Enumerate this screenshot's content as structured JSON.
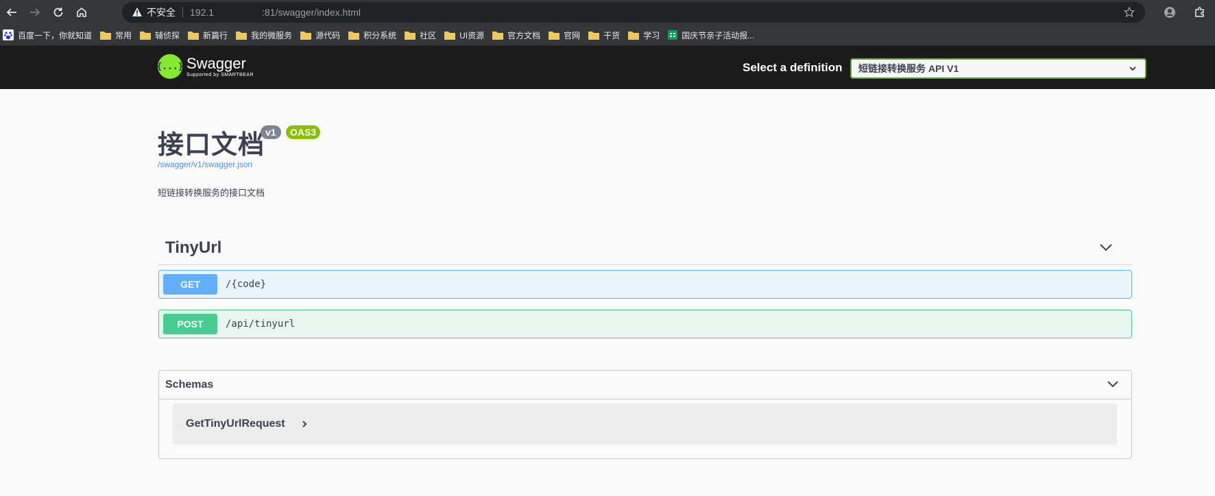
{
  "browser": {
    "insecure_label": "不安全",
    "url": "192.1     :81/swagger/index.html",
    "bookmarks": [
      {
        "label": "百度一下，你就知道",
        "icon": "baidu-icon"
      },
      {
        "label": "常用",
        "icon": "folder-icon"
      },
      {
        "label": "辅侦探",
        "icon": "folder-icon"
      },
      {
        "label": "新篇行",
        "icon": "folder-icon"
      },
      {
        "label": "我的微服务",
        "icon": "folder-icon"
      },
      {
        "label": "源代码",
        "icon": "folder-icon"
      },
      {
        "label": "积分系统",
        "icon": "folder-icon"
      },
      {
        "label": "社区",
        "icon": "folder-icon"
      },
      {
        "label": "UI资源",
        "icon": "folder-icon"
      },
      {
        "label": "官方文档",
        "icon": "folder-icon"
      },
      {
        "label": "官网",
        "icon": "folder-icon"
      },
      {
        "label": "干货",
        "icon": "folder-icon"
      },
      {
        "label": "学习",
        "icon": "folder-icon"
      },
      {
        "label": "国庆节亲子活动报...",
        "icon": "sheet-icon"
      }
    ]
  },
  "topbar": {
    "logo_text": "Swagger",
    "logo_sub": "Supported by SMARTBEAR",
    "logo_glyph": "{...}",
    "select_label": "Select a definition",
    "selected_definition": "短链接转换服务 API V1"
  },
  "info": {
    "title": "接口文档",
    "version": "v1",
    "oas": "OAS3",
    "spec_url": "/swagger/v1/swagger.json",
    "description": "短链接转换服务的接口文档"
  },
  "tag": {
    "name": "TinyUrl",
    "operations": [
      {
        "method": "GET",
        "path": "/{code}"
      },
      {
        "method": "POST",
        "path": "/api/tinyurl"
      }
    ]
  },
  "schemas": {
    "title": "Schemas",
    "models": [
      "GetTinyUrlRequest"
    ]
  },
  "colors": {
    "get": "#61affe",
    "post": "#49cc90",
    "topbar": "#1b1b1b",
    "accent": "#85ea2d"
  }
}
